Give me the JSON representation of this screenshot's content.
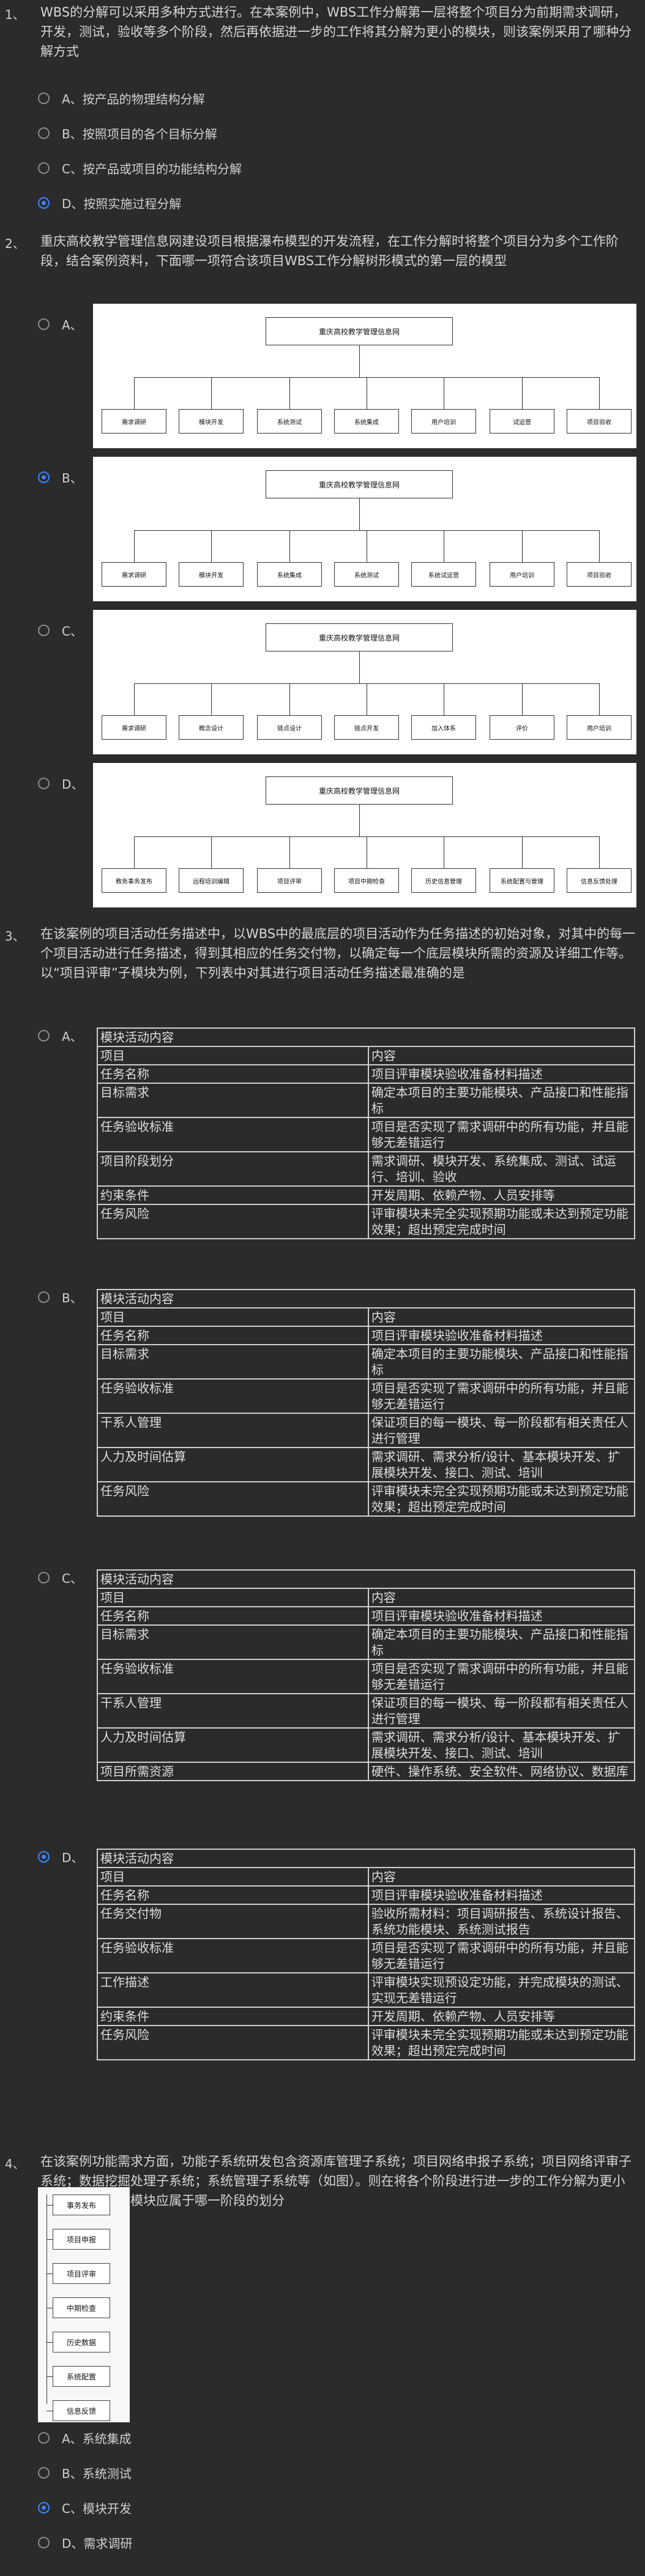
{
  "q1": {
    "num": "1、",
    "text": "WBS的分解可以采用多种方式进行。在本案例中，WBS工作分解第一层将整个项目分为前期需求调研，开发，测试，验收等多个阶段，然后再依据进一步的工作将其分解为更小的模块，则该案例采用了哪种分解方式",
    "options": [
      {
        "label": "A、按产品的物理结构分解",
        "selected": false
      },
      {
        "label": "B、按照项目的各个目标分解",
        "selected": false
      },
      {
        "label": "C、按产品或项目的功能结构分解",
        "selected": false
      },
      {
        "label": "D、按照实施过程分解",
        "selected": true
      }
    ]
  },
  "q2": {
    "num": "2、",
    "text": "重庆高校教学管理信息网建设项目根据瀑布模型的开发流程，在工作分解时将整个项目分为多个工作阶段，结合案例资料，下面哪一项符合该项目WBS工作分解树形模式的第一层的模型",
    "options": [
      {
        "label": "A、",
        "selected": false,
        "title": "重庆高校教学管理信息网",
        "leaves": [
          "需求调研",
          "模块开发",
          "系统测试",
          "系统集成",
          "用户培训",
          "试运营",
          "项目验收"
        ]
      },
      {
        "label": "B、",
        "selected": true,
        "title": "重庆高校教学管理信息网",
        "leaves": [
          "需求调研",
          "模块开发",
          "系统集成",
          "系统测试",
          "系统试运营",
          "用户培训",
          "项目验收"
        ]
      },
      {
        "label": "C、",
        "selected": false,
        "title": "重庆高校教学管理信息网",
        "leaves": [
          "需求调研",
          "概念设计",
          "链点设计",
          "链点开发",
          "加入体系",
          "评价",
          "用户培训"
        ]
      },
      {
        "label": "D、",
        "selected": false,
        "title": "重庆高校教学管理信息网",
        "leaves": [
          "教务事务发布",
          "远程培训编辑",
          "项目评审",
          "项目中期检查",
          "历史信息管理",
          "系统配置与管理",
          "信息反馈处理"
        ]
      }
    ]
  },
  "q3": {
    "num": "3、",
    "text": "在该案例的项目活动任务描述中，以WBS中的最底层的项目活动作为任务描述的初始对象，对其中的每一个项目活动进行任务描述，得到其相应的任务交付物，以确定每一个底层模块所需的资源及详细工作等。以“项目评审”子模块为例，下列表中对其进行项目活动任务描述最准确的是",
    "options": [
      {
        "label": "A、",
        "selected": false,
        "header": "模块活动内容",
        "rows": [
          [
            "项目",
            "内容"
          ],
          [
            "任务名称",
            "项目评审模块验收准备材料描述"
          ],
          [
            "目标需求",
            "确定本项目的主要功能模块、产品接口和性能指标"
          ],
          [
            "任务验收标准",
            "项目是否实现了需求调研中的所有功能，并且能够无差错运行"
          ],
          [
            "项目阶段划分",
            "需求调研、模块开发、系统集成、测试、试运行、培训、验收"
          ],
          [
            "约束条件",
            "开发周期、依赖产物、人员安排等"
          ],
          [
            "任务风险",
            "评审模块未完全实现预期功能或未达到预定功能效果；超出预定完成时间"
          ]
        ]
      },
      {
        "label": "B、",
        "selected": false,
        "header": "模块活动内容",
        "rows": [
          [
            "项目",
            "内容"
          ],
          [
            "任务名称",
            "项目评审模块验收准备材料描述"
          ],
          [
            "目标需求",
            "确定本项目的主要功能模块、产品接口和性能指标"
          ],
          [
            "任务验收标准",
            "项目是否实现了需求调研中的所有功能，并且能够无差错运行"
          ],
          [
            "干系人管理",
            "保证项目的每一模块、每一阶段都有相关责任人进行管理"
          ],
          [
            "人力及时间估算",
            "需求调研、需求分析/设计、基本模块开发、扩展模块开发、接口、测试、培训"
          ],
          [
            "任务风险",
            "评审模块未完全实现预期功能或未达到预定功能效果；超出预定完成时间"
          ]
        ]
      },
      {
        "label": "C、",
        "selected": false,
        "header": "模块活动内容",
        "rows": [
          [
            "项目",
            "内容"
          ],
          [
            "任务名称",
            "项目评审模块验收准备材料描述"
          ],
          [
            "目标需求",
            "确定本项目的主要功能模块、产品接口和性能指标"
          ],
          [
            "任务验收标准",
            "项目是否实现了需求调研中的所有功能，并且能够无差错运行"
          ],
          [
            "干系人管理",
            "保证项目的每一模块、每一阶段都有相关责任人进行管理"
          ],
          [
            "人力及时间估算",
            "需求调研、需求分析/设计、基本模块开发、扩展模块开发、接口、测试、培训"
          ],
          [
            "项目所需资源",
            "硬件、操作系统、安全软件、网络协议、数据库"
          ]
        ]
      },
      {
        "label": "D、",
        "selected": true,
        "header": "模块活动内容",
        "rows": [
          [
            "项目",
            "内容"
          ],
          [
            "任务名称",
            "项目评审模块验收准备材料描述"
          ],
          [
            "任务交付物",
            "验收所需材料：项目调研报告、系统设计报告、系统功能模块、系统测试报告"
          ],
          [
            "任务验收标准",
            "项目是否实现了需求调研中的所有功能，并且能够无差错运行"
          ],
          [
            "工作描述",
            "评审模块实现预设定功能，并完成模块的测试、实现无差错运行"
          ],
          [
            "约束条件",
            "开发周期、依赖产物、人员安排等"
          ],
          [
            "任务风险",
            "评审模块未完全实现预期功能或未达到预定功能效果；超出预定完成时间"
          ]
        ]
      }
    ]
  },
  "q4": {
    "num": "4、",
    "text": "在该案例功能需求方面，功能子系统研发包含资源库管理子系统；项目网络申报子系统；项目网络评审子系统；数据挖掘处理子系统；系统管理子系统等（如图）。则在将各个阶段进行进一步的工作分解为更小的模块时，图示模块应属于哪一阶段的划分",
    "tree": [
      "事务发布",
      "项目申报",
      "项目评审",
      "中期检查",
      "历史数据",
      "系统配置",
      "信息反馈"
    ],
    "options": [
      {
        "label": "A、系统集成",
        "selected": false
      },
      {
        "label": "B、系统测试",
        "selected": false
      },
      {
        "label": "C、模块开发",
        "selected": true
      },
      {
        "label": "D、需求调研",
        "selected": false
      }
    ]
  }
}
